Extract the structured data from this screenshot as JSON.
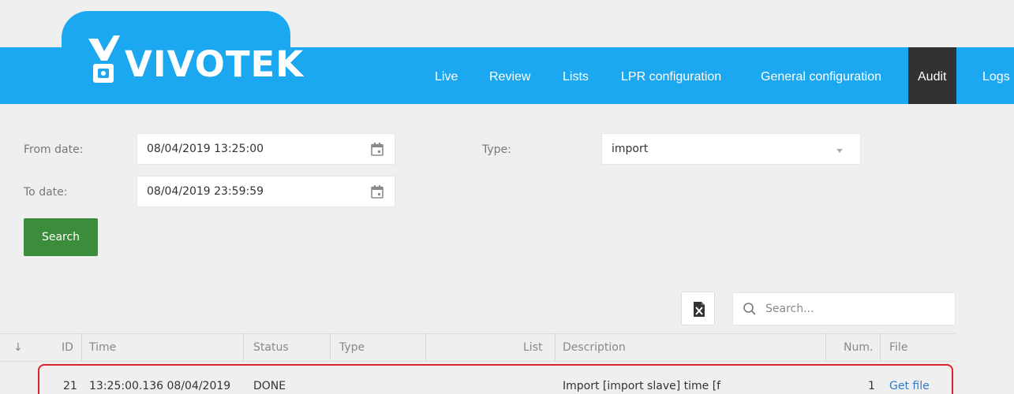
{
  "header": {
    "logo_text": "VIVOTEK",
    "nav": [
      {
        "label": "Live",
        "active": false
      },
      {
        "label": "Review",
        "active": false
      },
      {
        "label": "Lists",
        "active": false
      },
      {
        "label": "LPR configuration",
        "active": false
      },
      {
        "label": "General configuration",
        "active": false
      },
      {
        "label": "Audit",
        "active": true
      },
      {
        "label": "Logs",
        "active": false
      }
    ],
    "brand_color": "#1ca8f0",
    "active_tab_color": "#303234"
  },
  "filters": {
    "from_label": "From date:",
    "from_value": "08/04/2019 13:25:00",
    "to_label": "To date:",
    "to_value": "08/04/2019 23:59:59",
    "type_label": "Type:",
    "type_value": "import",
    "search_button": "Search",
    "date_icon": "calendar-icon",
    "search_button_color": "#3b8c3b"
  },
  "toolbar": {
    "export_icon": "excel-export-icon",
    "search_placeholder": "Search..."
  },
  "table": {
    "sort_indicator": "↓",
    "columns": [
      "ID",
      "Time",
      "Status",
      "Type",
      "List",
      "Description",
      "Num.",
      "File"
    ],
    "rows": [
      {
        "id": "21",
        "time": "13:25:00.136 08/04/2019",
        "status": "DONE",
        "type": "",
        "list": "",
        "description": "Import [import slave] time [f",
        "num": "1",
        "file": "Get file"
      }
    ],
    "highlight_color": "#d9232e"
  }
}
